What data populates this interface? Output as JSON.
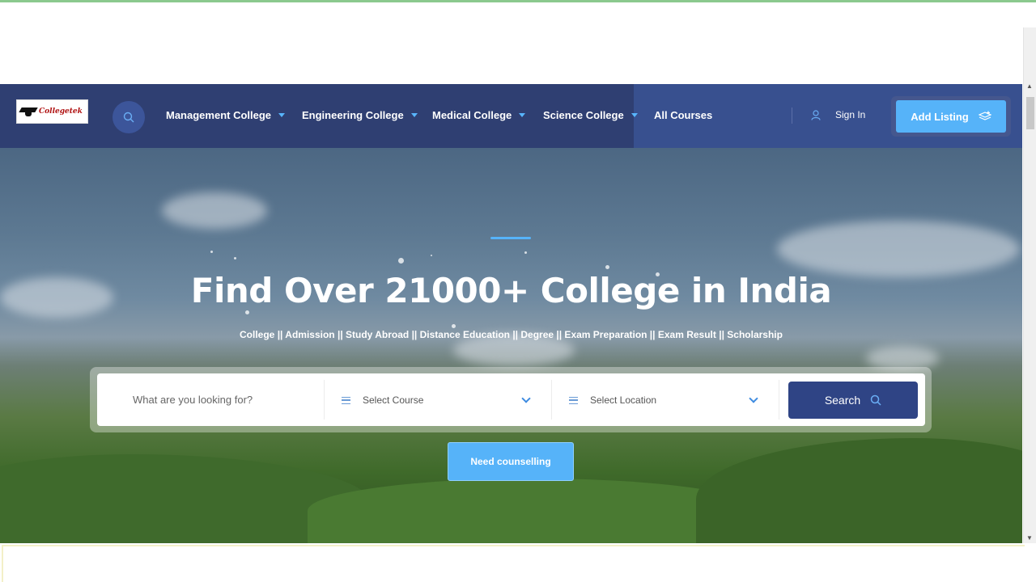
{
  "brand": {
    "logo_text": "Collegetek"
  },
  "nav": {
    "items": [
      {
        "label": "Management College",
        "has_dropdown": true
      },
      {
        "label": "Engineering College",
        "has_dropdown": true
      },
      {
        "label": "Medical College",
        "has_dropdown": true
      },
      {
        "label": "Science College",
        "has_dropdown": true
      },
      {
        "label": "All Courses",
        "has_dropdown": false
      }
    ],
    "sign_in": "Sign In",
    "add_listing": "Add Listing"
  },
  "hero": {
    "title": "Find Over 21000+ College in India",
    "subtitle": "College || Admission || Study Abroad || Distance Education || Degree || Exam Preparation || Exam Result || Scholarship"
  },
  "search": {
    "placeholder": "What are you looking for?",
    "course_select": "Select Course",
    "location_select": "Select Location",
    "button": "Search"
  },
  "cta": {
    "counselling": "Need counselling"
  },
  "colors": {
    "nav_bg": "#2f3f72",
    "accent": "#56b3f9",
    "search_button": "#2f4485"
  }
}
